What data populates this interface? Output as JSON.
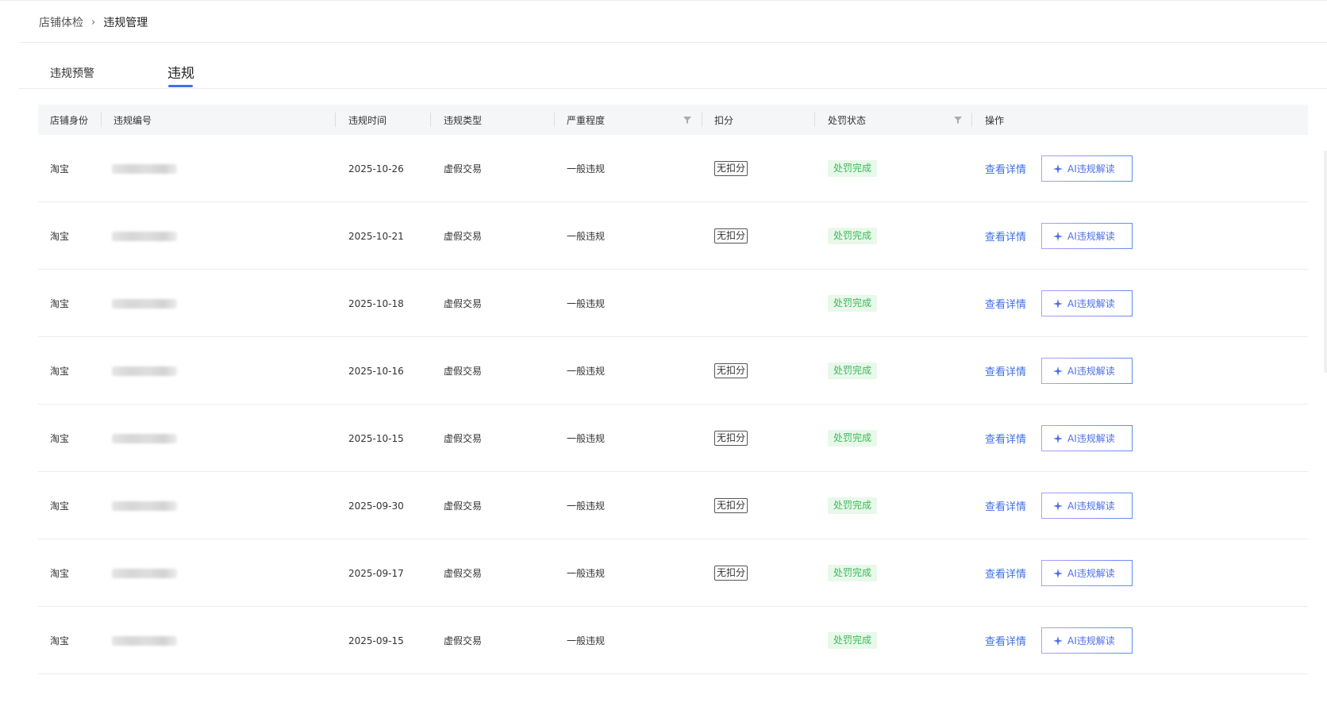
{
  "breadcrumb": {
    "parent": "店铺体检",
    "separator": "›",
    "current": "违规管理"
  },
  "tabs": [
    {
      "label": "违规预警",
      "active": false
    },
    {
      "label": "违规",
      "active": true
    }
  ],
  "table": {
    "headers": {
      "identity": "店铺身份",
      "number": "违规编号",
      "time": "违规时间",
      "type": "违规类型",
      "severity": "严重程度",
      "deduction": "扣分",
      "status": "处罚状态",
      "action": "操作"
    },
    "rows": [
      {
        "identity": "淘宝",
        "time": "2025-10-26",
        "type": "虚假交易",
        "severity": "一般违规",
        "deduction": "无扣分",
        "status": "处罚完成",
        "detail": "查看详情",
        "ai": "AI违规解读"
      },
      {
        "identity": "淘宝",
        "time": "2025-10-21",
        "type": "虚假交易",
        "severity": "一般违规",
        "deduction": "无扣分",
        "status": "处罚完成",
        "detail": "查看详情",
        "ai": "AI违规解读"
      },
      {
        "identity": "淘宝",
        "time": "2025-10-18",
        "type": "虚假交易",
        "severity": "一般违规",
        "deduction": "",
        "status": "处罚完成",
        "detail": "查看详情",
        "ai": "AI违规解读"
      },
      {
        "identity": "淘宝",
        "time": "2025-10-16",
        "type": "虚假交易",
        "severity": "一般违规",
        "deduction": "无扣分",
        "status": "处罚完成",
        "detail": "查看详情",
        "ai": "AI违规解读"
      },
      {
        "identity": "淘宝",
        "time": "2025-10-15",
        "type": "虚假交易",
        "severity": "一般违规",
        "deduction": "无扣分",
        "status": "处罚完成",
        "detail": "查看详情",
        "ai": "AI违规解读"
      },
      {
        "identity": "淘宝",
        "time": "2025-09-30",
        "type": "虚假交易",
        "severity": "一般违规",
        "deduction": "无扣分",
        "status": "处罚完成",
        "detail": "查看详情",
        "ai": "AI违规解读"
      },
      {
        "identity": "淘宝",
        "time": "2025-09-17",
        "type": "虚假交易",
        "severity": "一般违规",
        "deduction": "无扣分",
        "status": "处罚完成",
        "detail": "查看详情",
        "ai": "AI违规解读"
      },
      {
        "identity": "淘宝",
        "time": "2025-09-15",
        "type": "虚假交易",
        "severity": "一般违规",
        "deduction": "",
        "status": "处罚完成",
        "detail": "查看详情",
        "ai": "AI违规解读"
      }
    ]
  },
  "icons": {
    "filter": "filter-icon",
    "ai": "sparkle-icon"
  },
  "colors": {
    "accent": "#3f6fe6",
    "status_bg": "#e8f8ea",
    "status_text": "#3cb95a",
    "header_bg": "#f5f6f7"
  }
}
